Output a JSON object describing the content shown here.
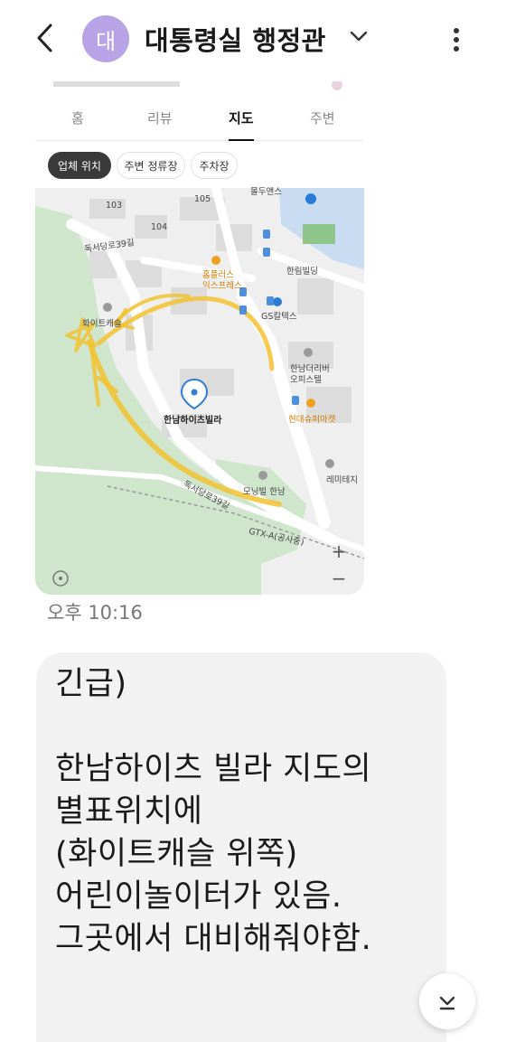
{
  "header": {
    "avatar_initial": "대",
    "contact_name": "대통령실 행정관"
  },
  "map_card": {
    "tabs": [
      {
        "label": "홈"
      },
      {
        "label": "리뷰"
      },
      {
        "label": "지도"
      },
      {
        "label": "주변"
      }
    ],
    "chips": [
      {
        "label": "업체 위치"
      },
      {
        "label": "주변 정류장"
      },
      {
        "label": "주차장"
      }
    ],
    "map_labels": {
      "b103": "103",
      "b104": "104",
      "b105": "105",
      "road_top": "독서당로39길",
      "homeplus": "홈플러스",
      "homeplus2": "익스프레스",
      "hanrim": "한림빌딩",
      "gs": "GS칼텍스",
      "white_capsule": "화이트캐슬",
      "hannam_the_river": "한남더리버",
      "hannam_the_river2": "오피스텔",
      "hyundai": "현대슈퍼마켓",
      "hannam_heights": "한남하이츠빌라",
      "morning_hannam": "모닝빌 한남",
      "remitage": "레미테지",
      "road_bottom": "독서당로39길",
      "gtx": "GTX-A(공사중)",
      "top_partial": "몰두앤스",
      "zoom_in": "+",
      "zoom_out": "−"
    }
  },
  "timestamp": "오후 10:16",
  "message": {
    "line1": "긴급)",
    "line2": "한남하이츠 빌라 지도의",
    "line3": "별표위치에",
    "line4": "(화이트캐슬 위쪽)",
    "line5": "어린이놀이터가 있음.",
    "line6": "그곳에서 대비해줘야함."
  },
  "colors": {
    "avatar": "#b7a3e6",
    "bubble": "#f2f2f2",
    "highlighter": "#f2c230"
  }
}
